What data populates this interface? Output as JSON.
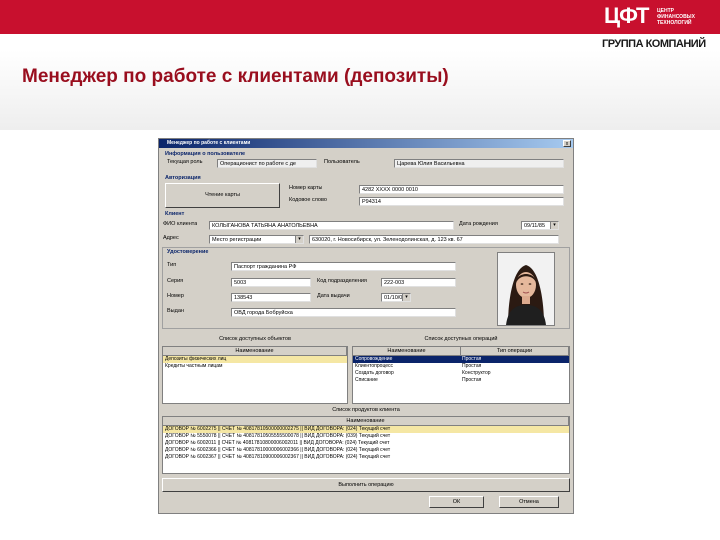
{
  "brand": {
    "logo_text": "ЦФТ",
    "logo_small": "ЦЕНТР ФИНАНСОВЫХ ТЕХНОЛОГИЙ",
    "group": "ГРУППА КОМПАНИЙ",
    "accent": "#c8102e"
  },
  "slide_title": "Менеджер по работе с клиентами (депозиты)",
  "window": {
    "title": "Менеджер по работе с клиентами",
    "close": "x",
    "user_info": {
      "section": "Информация о пользователе",
      "position_label": "Текущая роль",
      "position_value": "Операционист по работе с де",
      "user_label": "Пользователь",
      "user_value": "Царева Юлия Васильевна"
    },
    "auth": {
      "section": "Авторизация",
      "read_card": "Чтение карты",
      "card_no_label": "Номер карты",
      "card_no_value": "4282 XXXX 0000 0010",
      "code_label": "Кодовое слово",
      "code_value": "Р94314"
    },
    "client": {
      "section": "Клиент",
      "fio_label": "ФИО клиента",
      "fio_value": "КОЛЫГАНОВА ТАТЬЯНА АНАТОЛЬЕВНА",
      "dob_label": "Дата рождения",
      "dob_value": "09/11/85",
      "addr_label": "Адрес",
      "addr_type": "Место регистрации",
      "addr_value": "630020, г. Новосибирск, ул. Зеленодолинская, д. 123 кв. 67"
    },
    "document": {
      "section": "Удостоверение",
      "type_label": "Тип",
      "type_value": "Паспорт гражданина РФ",
      "series_label": "Серия",
      "series_value": "5003",
      "code_label": "Код подразделения",
      "code_value": "222-003",
      "number_label": "Номер",
      "number_value": "138543",
      "issued_date_label": "Дата выдачи",
      "issued_date_value": "01/10/03",
      "issued_by_label": "Выдан",
      "issued_by_value": "ОВД города Бобруйска"
    },
    "products": {
      "title": "Список доступных объектов",
      "header": "Наименование",
      "items": [
        "Депозиты физических лиц",
        "Кредиты частным лицам"
      ]
    },
    "operations": {
      "title": "Список доступных операций",
      "headers": [
        "Наименование",
        "Тип операции"
      ],
      "rows": [
        [
          "Сопровождение",
          "Простая"
        ],
        [
          "Клиентопроцесс ",
          "Простая"
        ],
        [
          "Создать договор",
          "Конструктор"
        ],
        [
          "Списание",
          "Простая"
        ]
      ]
    },
    "client_products": {
      "title": "Список продуктов клиента",
      "header": "Наименование",
      "rows": [
        "ДОГОВОР № 6002275 || СЧЕТ № 40817810500000002275 || ВИД ДОГОВОРА: (024) Текущий счет",
        "ДОГОВОР № 5550078 || СЧЕТ № 40817810505555500078 || ВИД ДОГОВОРА: (039) Текущий счет",
        "ДОГОВОР № 6002011 || СЧЕТ № 40817810800006002011 || ВИД ДОГОВОРА: (024) Текущий счет",
        "ДОГОВОР № 6002366 || СЧЕТ № 40817810000006002366 || ВИД ДОГОВОРА: (024) Текущий счет",
        "ДОГОВОР № 6002367 || СЧЕТ № 40817810900006002367 || ВИД ДОГОВОРА: (024) Текущий счет"
      ]
    },
    "run_op": "Выполнить операцию",
    "ok": "ОК",
    "cancel": "Отмена"
  }
}
